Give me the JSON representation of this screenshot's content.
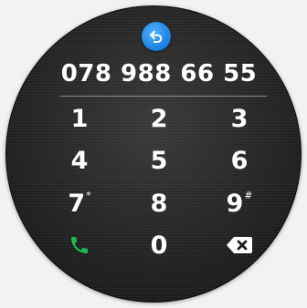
{
  "dialer": {
    "number": "078 988 66 55",
    "keys": [
      {
        "label": "1",
        "sup": ""
      },
      {
        "label": "2",
        "sup": ""
      },
      {
        "label": "3",
        "sup": ""
      },
      {
        "label": "4",
        "sup": ""
      },
      {
        "label": "5",
        "sup": ""
      },
      {
        "label": "6",
        "sup": ""
      },
      {
        "label": "7",
        "sup": "*"
      },
      {
        "label": "8",
        "sup": ""
      },
      {
        "label": "9",
        "sup": "#"
      },
      {
        "label": "0",
        "sup": ""
      }
    ],
    "icons": {
      "back": "back-arrow-icon",
      "call": "phone-call-icon",
      "delete": "backspace-icon"
    },
    "colors": {
      "accent_blue": "#2a8cf0",
      "call_green": "#1db954",
      "text": "#ffffff"
    }
  }
}
